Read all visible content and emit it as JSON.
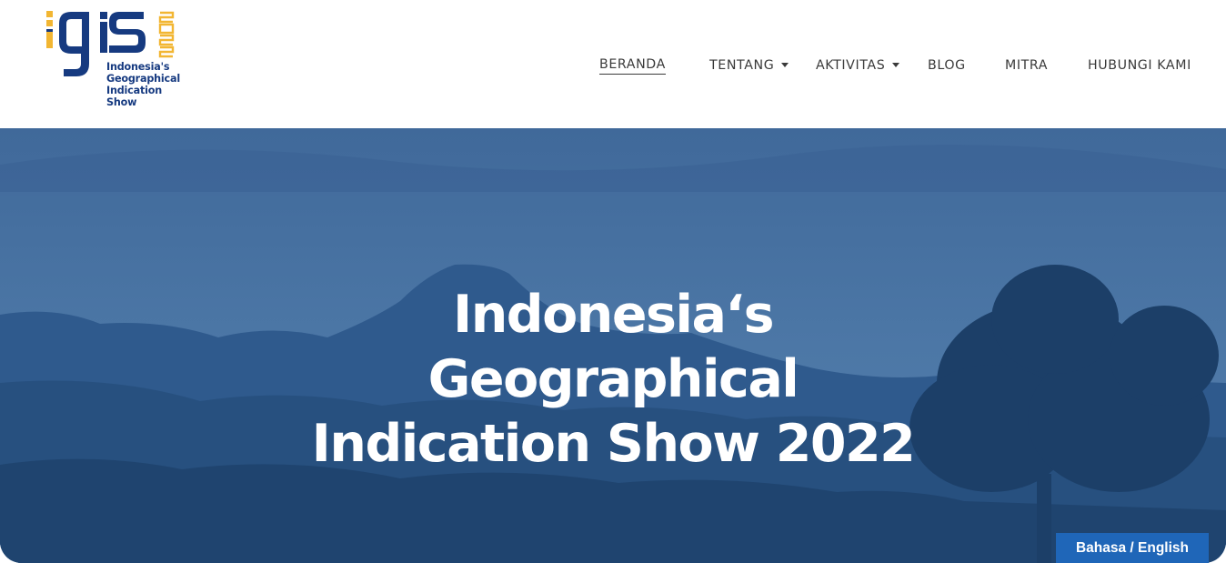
{
  "logo": {
    "mark": "igis",
    "year": "2022",
    "lines": [
      "Indonesia's",
      "Geographical",
      "Indication",
      "Show"
    ]
  },
  "nav": {
    "items": [
      {
        "label": "BERANDA",
        "active": true,
        "dropdown": false
      },
      {
        "label": "TENTANG",
        "active": false,
        "dropdown": true
      },
      {
        "label": "AKTIVITAS",
        "active": false,
        "dropdown": true
      },
      {
        "label": "BLOG",
        "active": false,
        "dropdown": false
      },
      {
        "label": "MITRA",
        "active": false,
        "dropdown": false
      },
      {
        "label": "HUBUNGI KAMI",
        "active": false,
        "dropdown": false
      }
    ]
  },
  "hero": {
    "title_lines": [
      "Indonesia‘s",
      "Geographical",
      "Indication Show 2022"
    ]
  },
  "language_toggle": {
    "label": "Bahasa / English"
  },
  "colors": {
    "brand_blue": "#163a80",
    "brand_yellow": "#f2b632",
    "hero_tint": "#3f6d9e",
    "button_blue": "#1f66b8",
    "nav_text": "#3a3a3a"
  }
}
